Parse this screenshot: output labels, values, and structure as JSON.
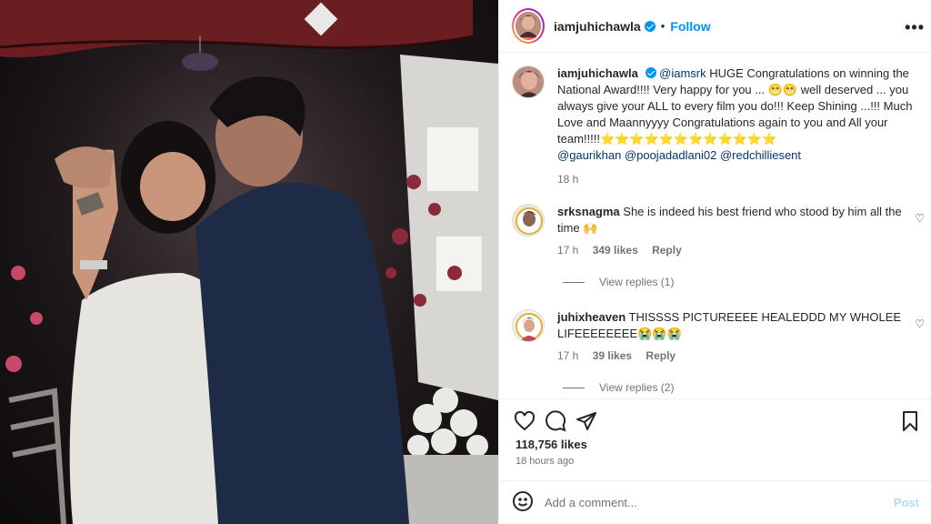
{
  "header": {
    "username": "iamjuhichawla",
    "separator": "•",
    "follow_label": "Follow",
    "more_label": "•••"
  },
  "caption": {
    "username": "iamjuhichawla",
    "mention": "@iamsrk",
    "text": "HUGE Congratulations on winning the National Award!!!! Very happy for you ... 😁😁 well deserved ... you always give your ALL to every film you do!!! Keep Shining ...!!! Much Love and Maannyyyy Congratulations again to you and All your team!!!!!⭐⭐⭐⭐⭐⭐⭐⭐⭐⭐⭐⭐",
    "tags": [
      "@gaurikhan",
      "@poojadadlani02",
      "@redchilliesent"
    ],
    "time": "18 h"
  },
  "comments": [
    {
      "username": "srksnagma",
      "text": "She is indeed his best friend who stood by him all the time 🙌",
      "time": "17 h",
      "likes": "349 likes",
      "reply_label": "Reply",
      "view_replies": "View replies (1)"
    },
    {
      "username": "juhixheaven",
      "text": "THISSSS PICTUREEEE HEALEDDD MY WHOLEE LIFEEEEEEEE😭😭😭",
      "time": "17 h",
      "likes": "39 likes",
      "reply_label": "Reply",
      "view_replies": "View replies (2)"
    }
  ],
  "actions": {
    "likes_count": "118,756 likes",
    "posted_ago": "18 hours ago"
  },
  "comment_box": {
    "placeholder": "Add a comment...",
    "post_label": "Post"
  },
  "colors": {
    "accent": "#0095f6",
    "link": "#00376b",
    "muted": "#737373",
    "post_disabled": "#b3dbff"
  },
  "icons": [
    "heart-icon",
    "comment-icon",
    "share-icon",
    "bookmark-icon",
    "emoji-icon",
    "more-icon",
    "verified-badge-icon"
  ]
}
